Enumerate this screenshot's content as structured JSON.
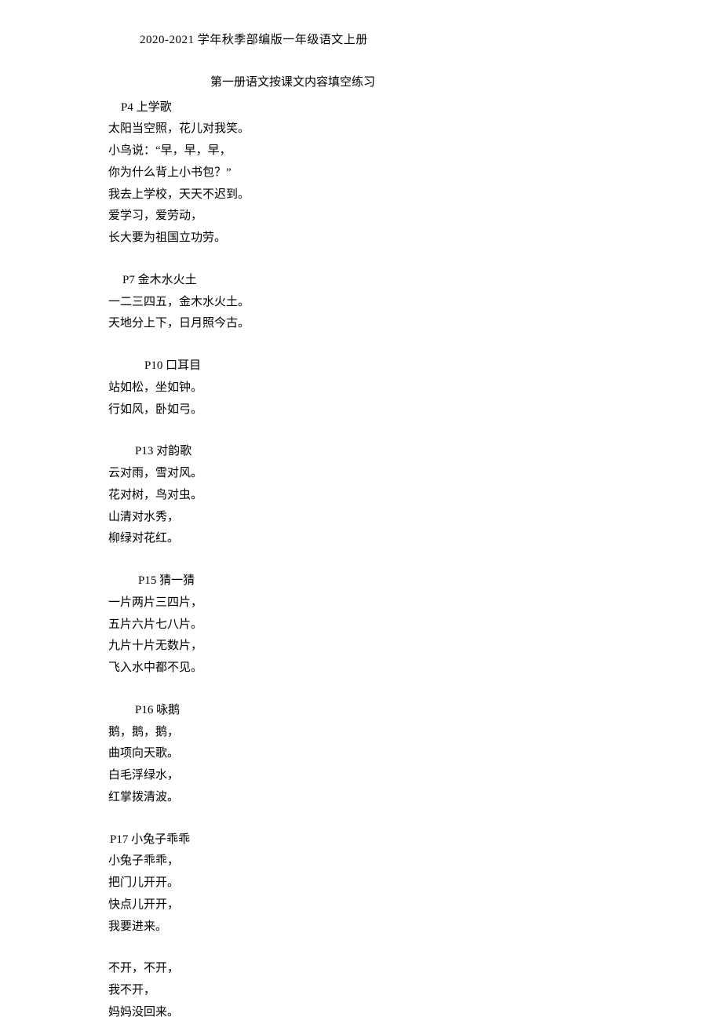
{
  "header": "2020-2021 学年秋季部编版一年级语文上册",
  "title": "第一册语文按课文内容填空练习",
  "sections": [
    {
      "heading": "P4 上学歌",
      "stanzas": [
        [
          "太阳当空照，花儿对我笑。",
          "小鸟说：“早，早，早，",
          "你为什么背上小书包？”",
          "我去上学校，天天不迟到。",
          "爱学习，爱劳动，",
          "长大要为祖国立功劳。"
        ]
      ]
    },
    {
      "heading": "P7 金木水火土",
      "stanzas": [
        [
          "一二三四五，金木水火土。",
          "天地分上下，日月照今古。"
        ]
      ]
    },
    {
      "heading": "P10 口耳目",
      "stanzas": [
        [
          "站如松，坐如钟。",
          "行如风，卧如弓。"
        ]
      ]
    },
    {
      "heading": "P13 对韵歌",
      "stanzas": [
        [
          "云对雨，雪对风。",
          "花对树，鸟对虫。",
          "山清对水秀，",
          "柳绿对花红。"
        ]
      ]
    },
    {
      "heading": "P15 猜一猜",
      "stanzas": [
        [
          "一片两片三四片，",
          "五片六片七八片。",
          "九片十片无数片，",
          "飞入水中都不见。"
        ]
      ]
    },
    {
      "heading": "P16 咏鹅",
      "stanzas": [
        [
          "鹅，鹅，鹅，",
          "曲项向天歌。",
          "白毛浮绿水，",
          "红掌拨清波。"
        ]
      ]
    },
    {
      "heading": "P17 小兔子乖乖",
      "stanzas": [
        [
          "小兔子乖乖，",
          "把门儿开开。",
          "快点儿开开，",
          "我要进来。"
        ],
        [
          "不开，不开，",
          "我不开，",
          "妈妈没回来。"
        ]
      ]
    }
  ]
}
